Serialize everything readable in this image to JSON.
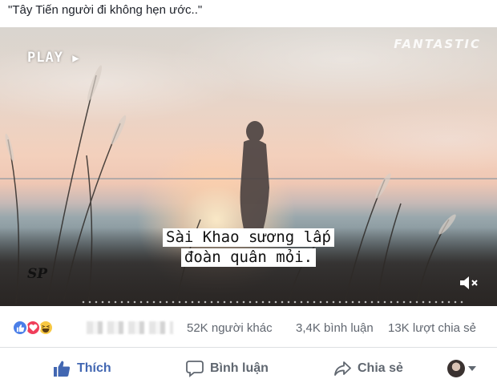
{
  "post": {
    "caption": "\"Tây Tiến người đi không hẹn ước..\""
  },
  "video": {
    "play_label": "PLAY",
    "play_glyph": "▶",
    "brand": "FANTASTIC",
    "channel_logo": "SP",
    "subtitle_lines": [
      "Sài Khao sương lấp",
      "đoàn quân mỏi."
    ],
    "mute_icon": "speaker-muted-icon"
  },
  "reactions": {
    "icons": [
      "like-reaction-icon",
      "love-reaction-icon",
      "haha-reaction-icon"
    ],
    "others": "52K người khác",
    "comments": "3,4K bình luận",
    "shares": "13K lượt chia sẻ"
  },
  "actions": {
    "like": "Thích",
    "comment": "Bình luận",
    "share": "Chia sẻ"
  },
  "colors": {
    "like_blue": "#4267b2",
    "text_secondary": "#616770",
    "love_red": "#f03e5a",
    "haha_yellow": "#f7c843"
  }
}
